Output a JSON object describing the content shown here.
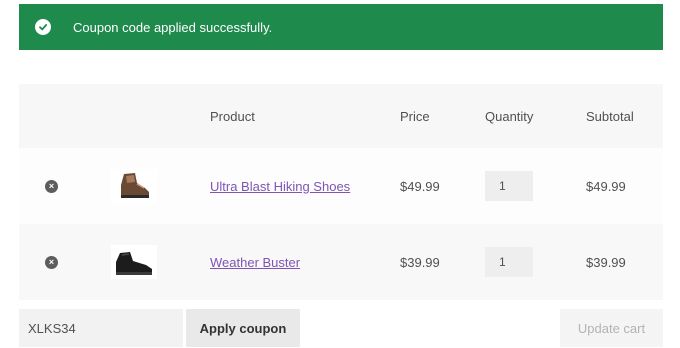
{
  "notice": {
    "message": "Coupon code applied successfully.",
    "icon": "check-circle-icon",
    "color": "#1e8a4c"
  },
  "cart": {
    "headers": {
      "product": "Product",
      "price": "Price",
      "quantity": "Quantity",
      "subtotal": "Subtotal"
    },
    "items": [
      {
        "name": "Ultra Blast Hiking Shoes",
        "price": "$49.99",
        "quantity": "1",
        "subtotal": "$49.99",
        "remove_icon": "remove-circle-icon",
        "thumb_icon": "hiking-shoe-icon"
      },
      {
        "name": "Weather Buster",
        "price": "$39.99",
        "quantity": "1",
        "subtotal": "$39.99",
        "remove_icon": "remove-circle-icon",
        "thumb_icon": "boot-icon"
      }
    ]
  },
  "actions": {
    "coupon_value": "XLKS34",
    "apply_label": "Apply coupon",
    "update_label": "Update cart"
  }
}
